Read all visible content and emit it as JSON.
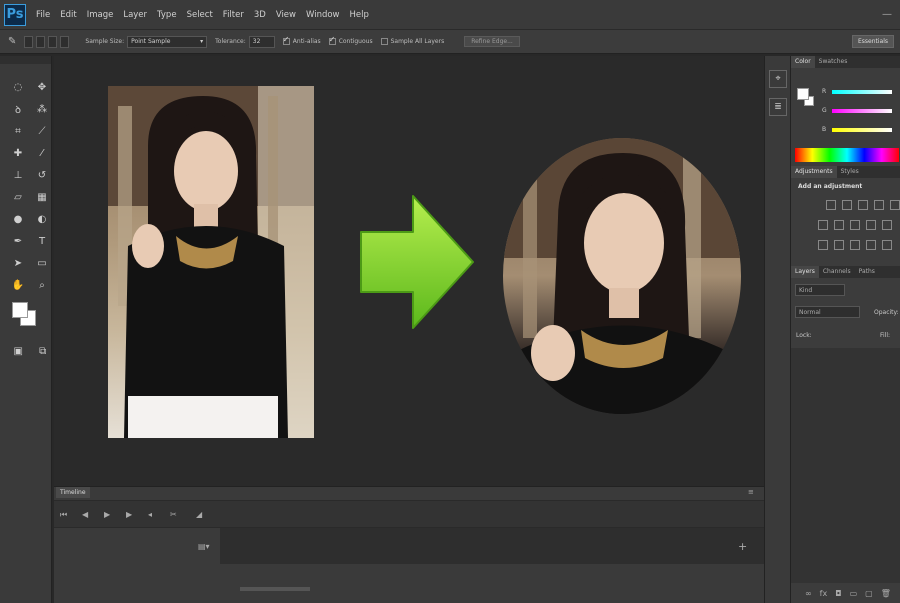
{
  "app": {
    "logo": "Ps",
    "menu": [
      "File",
      "Edit",
      "Image",
      "Layer",
      "Type",
      "Select",
      "Filter",
      "3D",
      "View",
      "Window",
      "Help"
    ]
  },
  "options": {
    "sample_size_label": "Sample Size:",
    "sample_size_value": "Point Sample",
    "tolerance_label": "Tolerance:",
    "tolerance_value": "32",
    "anti_alias": "Anti-alias",
    "contiguous": "Contiguous",
    "sample_all_layers": "Sample All Layers",
    "refine_edge": "Refine Edge...",
    "workspace": "Essentials"
  },
  "timeline": {
    "tab": "Timeline"
  },
  "panels": {
    "color_tabs": [
      "Color",
      "Swatches"
    ],
    "color_labels": [
      "R",
      "G",
      "B"
    ],
    "adjust_tabs": [
      "Adjustments",
      "Styles"
    ],
    "adjust_heading": "Add an adjustment",
    "layer_tabs": [
      "Layers",
      "Channels",
      "Paths"
    ],
    "layer_kind": "Kind",
    "layer_blend": "Normal",
    "layer_opacity": "Opacity:",
    "layer_lock": "Lock:",
    "layer_fill": "Fill:"
  },
  "colors": {
    "arrow": "#7fd12a",
    "panel": "#3c3c3c",
    "canvas": "#2a2a2a"
  }
}
